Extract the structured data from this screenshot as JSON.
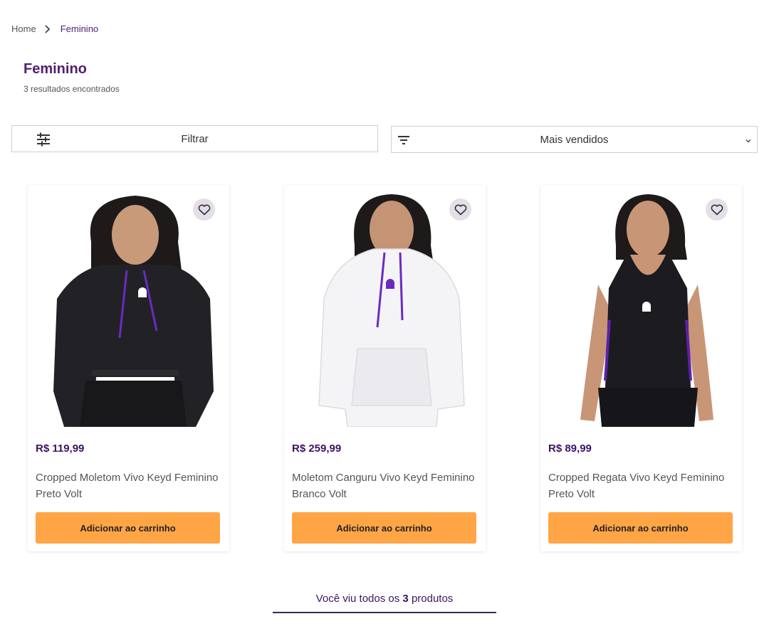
{
  "breadcrumb": {
    "home": "Home",
    "current": "Feminino"
  },
  "page": {
    "title": "Feminino",
    "result_count": "3 resultados encontrados"
  },
  "toolbar": {
    "filter_label": "Filtrar",
    "sort_selected": "Mais vendidos"
  },
  "products": [
    {
      "price": "R$ 119,99",
      "name": "Cropped Moletom Vivo Keyd Feminino Preto Volt",
      "cta": "Adicionar ao carrinho"
    },
    {
      "price": "R$ 259,99",
      "name": "Moletom Canguru Vivo Keyd Feminino Branco Volt",
      "cta": "Adicionar ao carrinho"
    },
    {
      "price": "R$ 89,99",
      "name": "Cropped Regata Vivo Keyd Feminino Preto Volt",
      "cta": "Adicionar ao carrinho"
    }
  ],
  "footer": {
    "seen_prefix": "Você viu todos os",
    "seen_count": "3",
    "seen_suffix": "produtos",
    "progress": 1.0
  },
  "colors": {
    "accent": "#52206f",
    "price": "#3d1365",
    "cta": "#ffa545",
    "fav_bg": "#e2e0e4"
  },
  "icons": {
    "separator": "chevron-right-icon",
    "filter": "sliders-icon",
    "sort": "sort-icon",
    "dropdown": "chevron-down-icon",
    "favorite": "heart-icon"
  }
}
